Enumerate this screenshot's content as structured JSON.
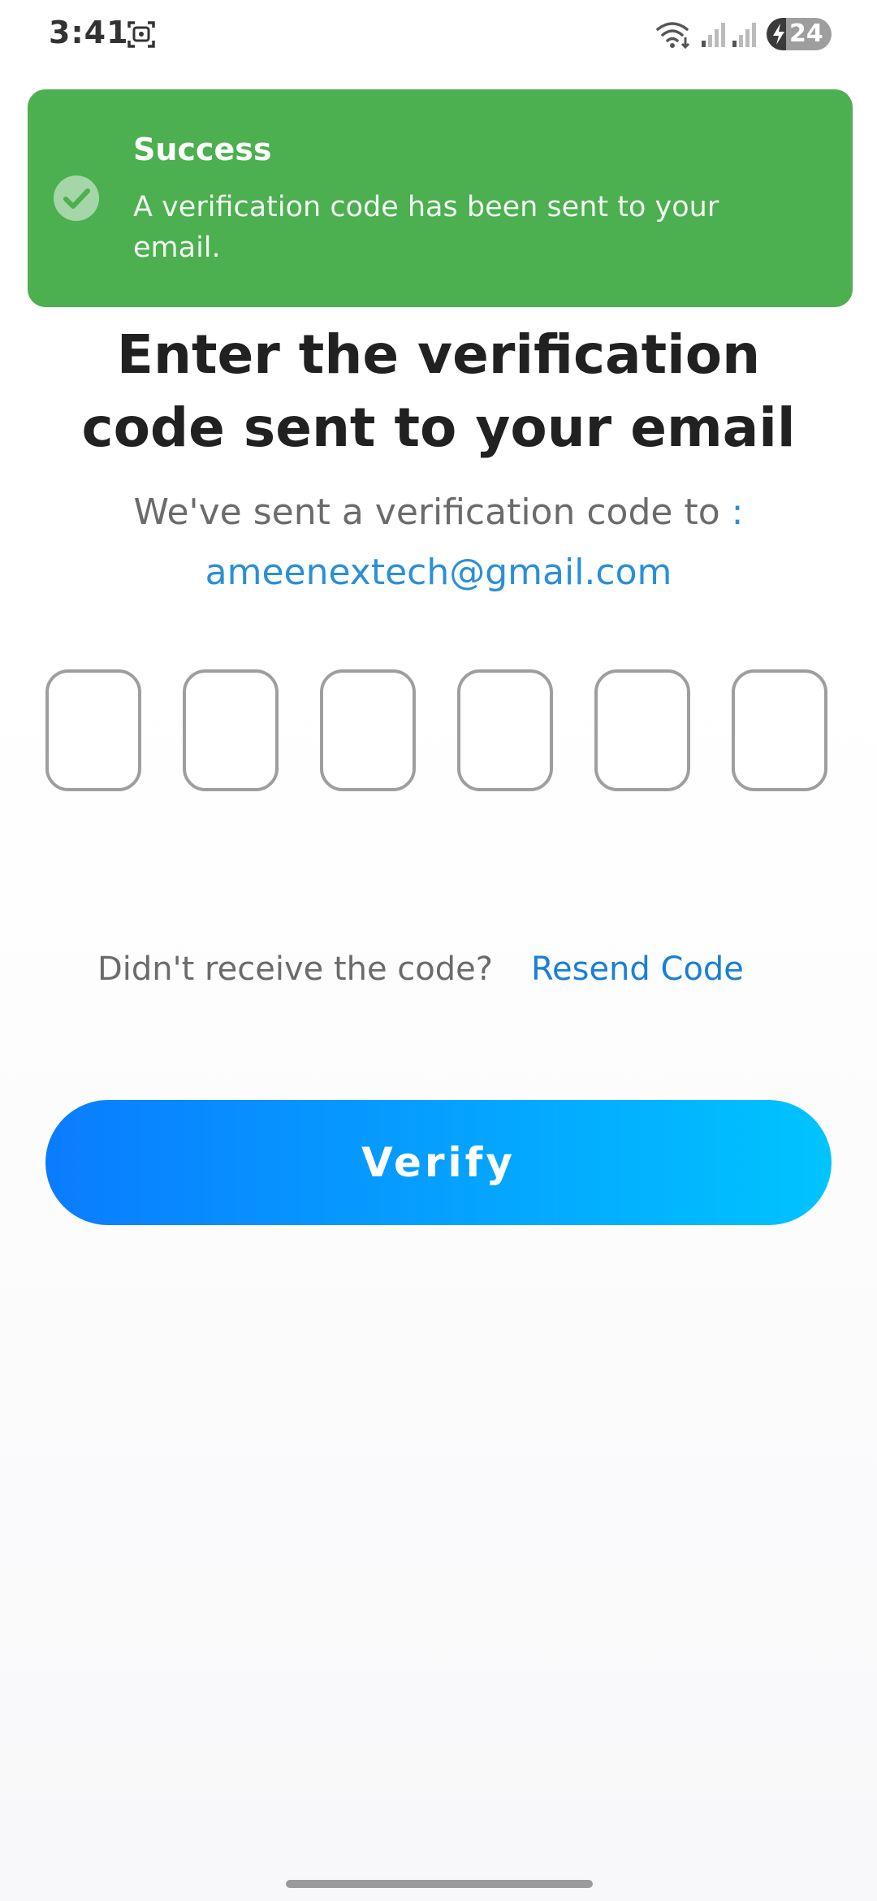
{
  "status_bar": {
    "time": "3:41",
    "battery_level": "24",
    "icons": [
      "screenshot-icon",
      "wifi-icon",
      "signal-icon",
      "signal-icon",
      "battery-icon",
      "charging-bolt-icon"
    ]
  },
  "toast": {
    "title": "Success",
    "message": "A verification code has been sent to your email.",
    "icon": "check-circle-icon",
    "background_color": "#4caf50"
  },
  "page": {
    "heading": "Enter the verification code sent to your email",
    "subtext_prefix": "We've sent a verification code to",
    "subtext_colon": ":",
    "email": "ameenextech@gmail.com"
  },
  "code_input": {
    "digits": [
      "",
      "",
      "",
      "",
      "",
      ""
    ]
  },
  "resend": {
    "prompt": "Didn't receive the code?",
    "link_label": "Resend Code"
  },
  "verify_button": {
    "label": "Verify",
    "gradient_start": "#0a7cff",
    "gradient_end": "#00c4ff"
  },
  "colors": {
    "accent": "#2a8fd8",
    "heading": "#212121",
    "muted_text": "#6b6b6b"
  }
}
